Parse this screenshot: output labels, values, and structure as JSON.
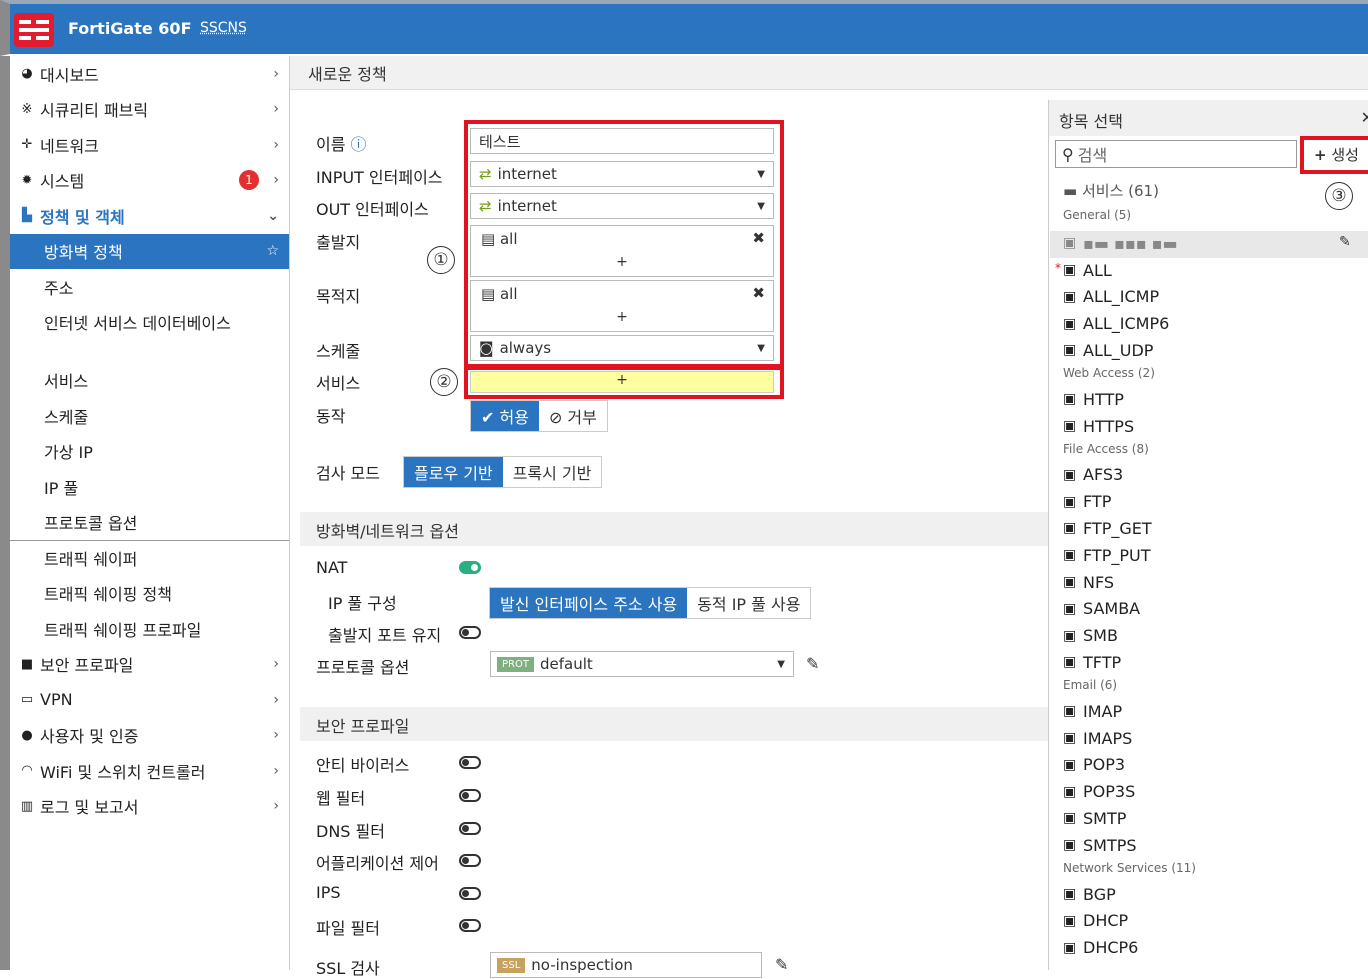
{
  "topbar": {
    "product": "FortiGate 60F",
    "hostname": "SSCNS"
  },
  "sidebar": {
    "items": [
      {
        "label": "대시보드",
        "icon": "dashboard-icon"
      },
      {
        "label": "시큐리티 패브릭",
        "icon": "fabric-icon"
      },
      {
        "label": "네트워크",
        "icon": "network-icon"
      },
      {
        "label": "시스템",
        "icon": "gear-icon",
        "badge": "1"
      },
      {
        "label": "정책 및 객체",
        "icon": "policy-icon"
      },
      {
        "label": "방화벽 정책"
      },
      {
        "label": "주소"
      },
      {
        "label": "인터넷 서비스 데이터베이스"
      },
      {
        "label": "서비스"
      },
      {
        "label": "스케줄"
      },
      {
        "label": "가상 IP"
      },
      {
        "label": "IP 풀"
      },
      {
        "label": "프로토콜 옵션"
      },
      {
        "label": "트래픽 쉐이퍼"
      },
      {
        "label": "트래픽 쉐이핑 정책"
      },
      {
        "label": "트래픽 쉐이핑 프로파일"
      },
      {
        "label": "보안 프로파일",
        "icon": "lock-icon"
      },
      {
        "label": "VPN",
        "icon": "monitor-icon"
      },
      {
        "label": "사용자 및 인증",
        "icon": "user-icon"
      },
      {
        "label": "WiFi 및 스위치 컨트롤러",
        "icon": "wifi-icon"
      },
      {
        "label": "로그 및 보고서",
        "icon": "chart-icon"
      }
    ]
  },
  "page": {
    "title": "새로운 정책"
  },
  "form": {
    "name_label": "이름",
    "name_value": "테스트",
    "input_if_label": "INPUT 인터페이스",
    "input_if_value": "internet",
    "out_if_label": "OUT 인터페이스",
    "out_if_value": "internet",
    "src_label": "출발지",
    "src_value": "all",
    "dst_label": "목적지",
    "dst_value": "all",
    "schedule_label": "스케줄",
    "schedule_value": "always",
    "service_label": "서비스",
    "action_label": "동작",
    "action_accept": "✔ 허용",
    "action_deny": "⊘ 거부",
    "inspect_label": "검사 모드",
    "inspect_flow": "플로우 기반",
    "inspect_proxy": "프록시 기반",
    "plus": "+",
    "remove": "✖"
  },
  "annotations": {
    "one": "①",
    "two": "②",
    "three": "③"
  },
  "fw_section": {
    "title": "방화벽/네트워크 옵션",
    "nat_label": "NAT",
    "ippool_label": "IP 풀 구성",
    "ippool_opt1": "발신 인터페이스 주소 사용",
    "ippool_opt2": "동적 IP 풀 사용",
    "preserve_port_label": "출발지 포트 유지",
    "proto_opt_label": "프로토콜 옵션",
    "proto_tag": "PROT",
    "proto_value": "default"
  },
  "sec_section": {
    "title": "보안 프로파일",
    "items": [
      "안티 바이러스",
      "웹 필터",
      "DNS 필터",
      "어플리케이션 제어",
      "IPS",
      "파일 필터"
    ],
    "ssl_label": "SSL 검사",
    "ssl_tag": "SSL",
    "ssl_value": "no-inspection"
  },
  "panel": {
    "title": "항목 선택",
    "search_placeholder": "검색",
    "create_label": "생성",
    "group": "서비스 (61)",
    "categories": [
      {
        "name": "General (5)",
        "items": [
          "ALL",
          "ALL_ICMP",
          "ALL_ICMP6",
          "ALL_UDP"
        ]
      },
      {
        "name": "Web Access (2)",
        "items": [
          "HTTP",
          "HTTPS"
        ]
      },
      {
        "name": "File Access (8)",
        "items": [
          "AFS3",
          "FTP",
          "FTP_GET",
          "FTP_PUT",
          "NFS",
          "SAMBA",
          "SMB",
          "TFTP"
        ]
      },
      {
        "name": "Email (6)",
        "items": [
          "IMAP",
          "IMAPS",
          "POP3",
          "POP3S",
          "SMTP",
          "SMTPS"
        ]
      },
      {
        "name": "Network Services (11)",
        "items": [
          "BGP",
          "DHCP",
          "DHCP6"
        ]
      }
    ]
  }
}
